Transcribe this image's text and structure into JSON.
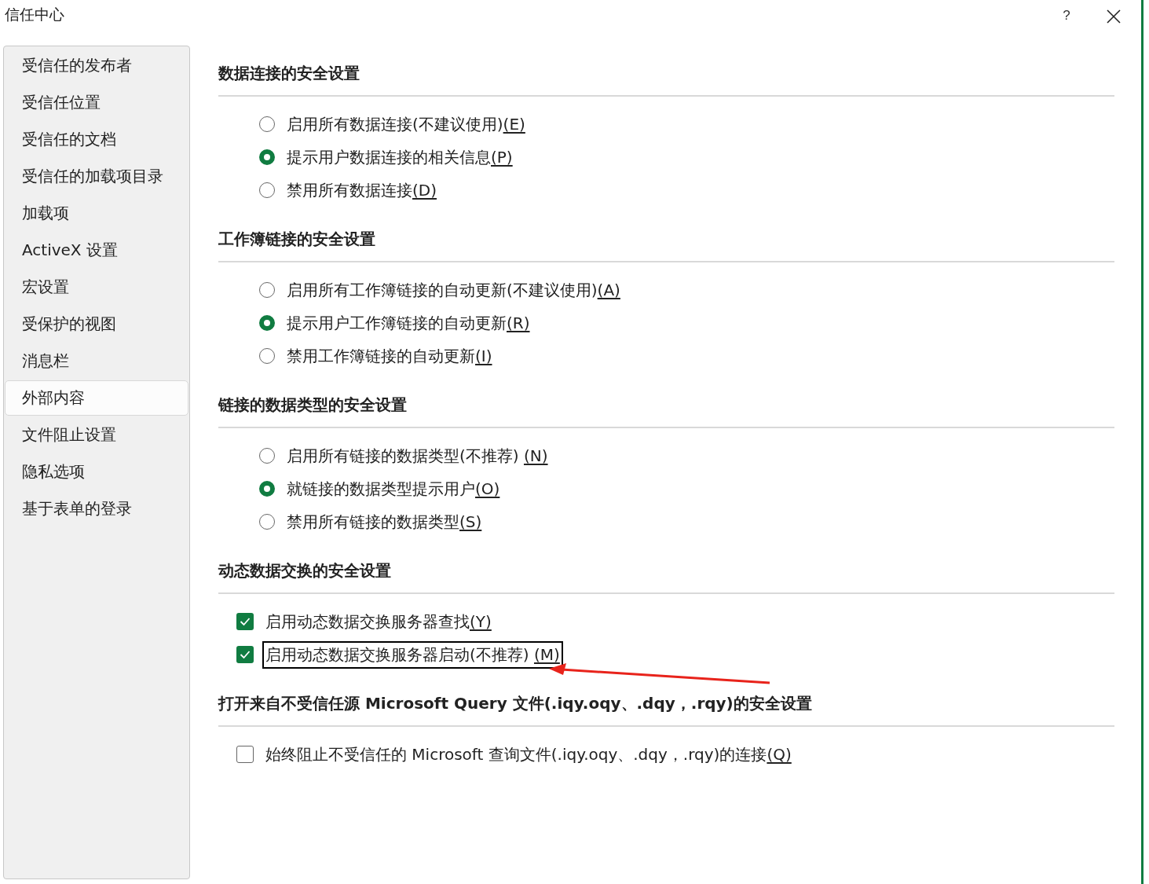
{
  "window": {
    "title": "信任中心",
    "help": "?"
  },
  "sidebar": {
    "items": [
      {
        "label": "受信任的发布者",
        "selected": false
      },
      {
        "label": "受信任位置",
        "selected": false
      },
      {
        "label": "受信任的文档",
        "selected": false
      },
      {
        "label": "受信任的加载项目录",
        "selected": false
      },
      {
        "label": "加载项",
        "selected": false
      },
      {
        "label": "ActiveX 设置",
        "selected": false
      },
      {
        "label": "宏设置",
        "selected": false
      },
      {
        "label": "受保护的视图",
        "selected": false
      },
      {
        "label": "消息栏",
        "selected": false
      },
      {
        "label": "外部内容",
        "selected": true
      },
      {
        "label": "文件阻止设置",
        "selected": false
      },
      {
        "label": "隐私选项",
        "selected": false
      },
      {
        "label": "基于表单的登录",
        "selected": false
      }
    ]
  },
  "sections": [
    {
      "title": "数据连接的安全设置",
      "options": [
        {
          "kind": "radio",
          "label": "启用所有数据连接(不建议使用)",
          "key": "(E)",
          "selected": false
        },
        {
          "kind": "radio",
          "label": "提示用户数据连接的相关信息",
          "key": "(P)",
          "selected": true
        },
        {
          "kind": "radio",
          "label": "禁用所有数据连接",
          "key": "(D)",
          "selected": false
        }
      ]
    },
    {
      "title": "工作簿链接的安全设置",
      "options": [
        {
          "kind": "radio",
          "label": "启用所有工作簿链接的自动更新(不建议使用)",
          "key": "(A)",
          "selected": false
        },
        {
          "kind": "radio",
          "label": "提示用户工作簿链接的自动更新",
          "key": "(R)",
          "selected": true
        },
        {
          "kind": "radio",
          "label": "禁用工作簿链接的自动更新",
          "key": "(I)",
          "selected": false
        }
      ]
    },
    {
      "title": "链接的数据类型的安全设置",
      "options": [
        {
          "kind": "radio",
          "label": "启用所有链接的数据类型(不推荐) ",
          "key": "(N)",
          "selected": false
        },
        {
          "kind": "radio",
          "label": "就链接的数据类型提示用户",
          "key": "(O)",
          "selected": true
        },
        {
          "kind": "radio",
          "label": "禁用所有链接的数据类型",
          "key": "(S)",
          "selected": false
        }
      ]
    },
    {
      "title": "动态数据交换的安全设置",
      "options": [
        {
          "kind": "checkbox",
          "label": "启用动态数据交换服务器查找",
          "key": "(Y)",
          "checked": true,
          "highlighted": false
        },
        {
          "kind": "checkbox",
          "label": "启用动态数据交换服务器启动(不推荐) ",
          "key": "(M)",
          "checked": true,
          "highlighted": true
        }
      ]
    },
    {
      "title": "打开来自不受信任源 Microsoft Query 文件(.iqy.oqy、.dqy，.rqy)的安全设置",
      "options": [
        {
          "kind": "checkbox",
          "label": "始终阻止不受信任的 Microsoft 查询文件(.iqy.oqy、.dqy，.rqy)的连接",
          "key": "(Q)",
          "checked": false,
          "highlighted": false
        }
      ]
    }
  ]
}
